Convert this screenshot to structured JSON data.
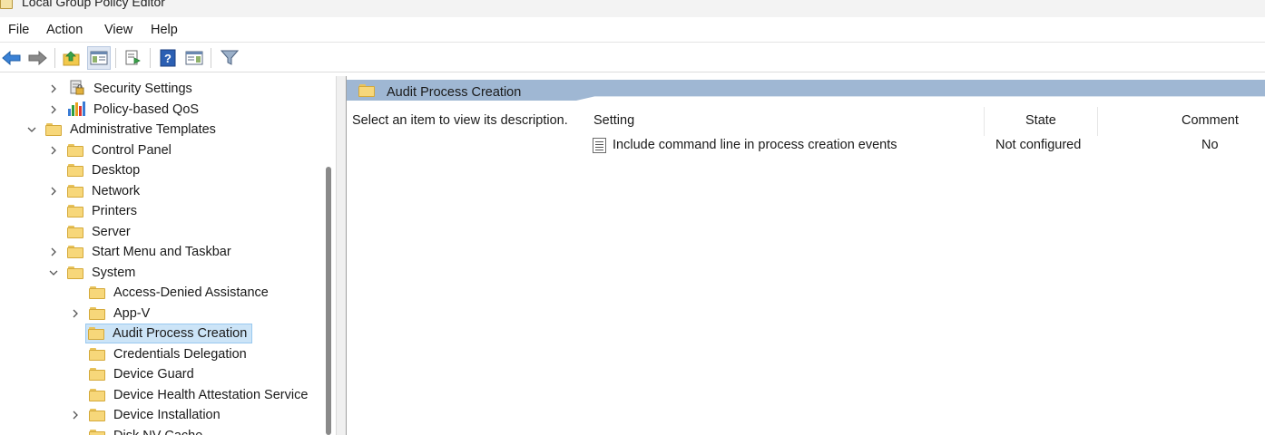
{
  "window": {
    "title": "Local Group Policy Editor"
  },
  "menu": [
    "File",
    "Action",
    "View",
    "Help"
  ],
  "toolbar": {
    "icons": [
      "back-arrow-icon",
      "forward-arrow-icon",
      "up-folder-icon",
      "show-hide-tree-icon",
      "export-list-icon",
      "help-icon",
      "action-pane-icon",
      "filter-icon"
    ]
  },
  "tree": {
    "items": [
      {
        "label": "Security Settings",
        "icon": "security-settings-icon"
      },
      {
        "label": "Policy-based QoS",
        "icon": "chart-bars-icon"
      },
      {
        "label": "Administrative Templates",
        "icon": "folder-icon"
      },
      {
        "label": "Control Panel",
        "icon": "folder-icon"
      },
      {
        "label": "Desktop",
        "icon": "folder-icon"
      },
      {
        "label": "Network",
        "icon": "folder-icon"
      },
      {
        "label": "Printers",
        "icon": "folder-icon"
      },
      {
        "label": "Server",
        "icon": "folder-icon"
      },
      {
        "label": "Start Menu and Taskbar",
        "icon": "folder-icon"
      },
      {
        "label": "System",
        "icon": "folder-icon"
      },
      {
        "label": "Access-Denied Assistance",
        "icon": "folder-icon"
      },
      {
        "label": "App-V",
        "icon": "folder-icon"
      },
      {
        "label": "Audit Process Creation",
        "icon": "folder-icon"
      },
      {
        "label": "Credentials Delegation",
        "icon": "folder-icon"
      },
      {
        "label": "Device Guard",
        "icon": "folder-icon"
      },
      {
        "label": "Device Health Attestation Service",
        "icon": "folder-icon"
      },
      {
        "label": "Device Installation",
        "icon": "folder-icon"
      },
      {
        "label": "Disk NV Cache",
        "icon": "folder-icon"
      }
    ],
    "selected": "Audit Process Creation"
  },
  "details": {
    "header_title": "Audit Process Creation",
    "description_prompt": "Select an item to view its description.",
    "columns": [
      "Setting",
      "State",
      "Comment"
    ],
    "rows": [
      {
        "setting": "Include command line in process creation events",
        "state": "Not configured",
        "comment": "No"
      }
    ]
  },
  "colors": {
    "header_band": "#9fb7d3",
    "selection_bg": "#cce4f7",
    "folder_yellow": "#f7d77a"
  }
}
